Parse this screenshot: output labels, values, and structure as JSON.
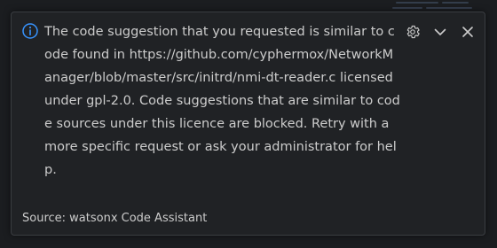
{
  "notification": {
    "icon": "info-icon",
    "message": "The code suggestion that you requested is similar to code found in https://github.com/cyphermox/NetworkManager/blob/master/src/initrd/nmi-dt-reader.c licensed under gpl-2.0. Code suggestions that are similar to code sources under this licence are blocked. Retry with a more specific request or ask your administrator for help.",
    "source": "Source: watsonx Code Assistant",
    "actions": {
      "settings_icon": "gear-icon",
      "expand_icon": "chevron-down-icon",
      "close_icon": "close-icon"
    }
  },
  "colors": {
    "background": "#1b1d20",
    "toast_background": "#202225",
    "toast_border": "#3a3d41",
    "text": "#cccccc",
    "info_accent": "#3794ff"
  }
}
